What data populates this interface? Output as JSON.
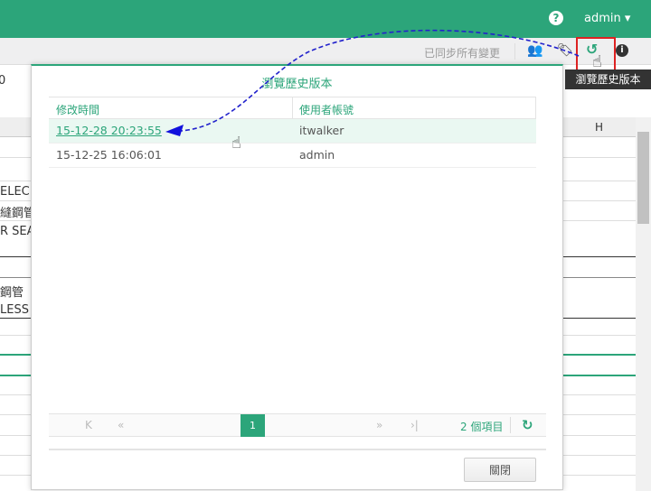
{
  "topbar": {
    "help_icon": "question-circle-icon",
    "user": "admin ▾"
  },
  "toolbar": {
    "sync_status": "已同步所有變更",
    "tooltip": "瀏覽歷史版本",
    "icons": [
      "users-icon",
      "tag-icon",
      "history-icon",
      "info-icon"
    ]
  },
  "sheet": {
    "row_label": "0",
    "column_h": "H",
    "cells": [
      "ELEC",
      "縫鋼管",
      "R SEA",
      "鋼管（",
      "LESS"
    ]
  },
  "modal": {
    "title": "瀏覽歷史版本",
    "columns": [
      "修改時間",
      "使用者帳號"
    ],
    "rows": [
      {
        "time": "15-12-28 20:23:55",
        "user": "itwalker"
      },
      {
        "time": "15-12-25 16:06:01",
        "user": "admin"
      }
    ],
    "pager": {
      "first": "K",
      "prev": "«",
      "page": "1",
      "next": "»",
      "last": "›|",
      "count": "2 個項目"
    },
    "close_label": "關閉"
  },
  "colors": {
    "accent": "#2ca57a",
    "arrow": "#2222cc",
    "highlight": "#dd2222"
  }
}
